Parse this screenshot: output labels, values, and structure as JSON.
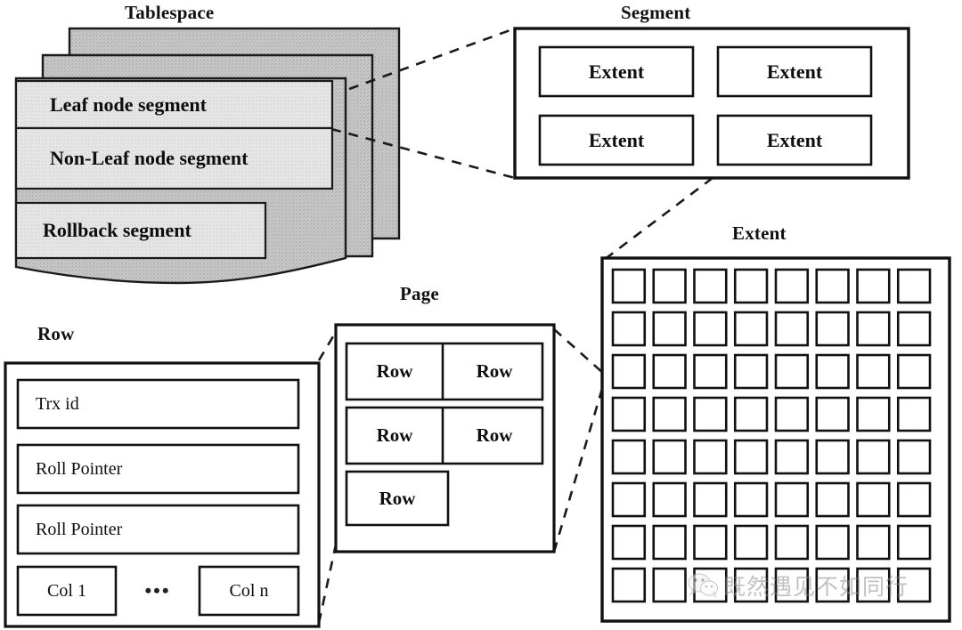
{
  "diagram": {
    "title_labels": {
      "tablespace": "Tablespace",
      "segment": "Segment",
      "extent": "Extent",
      "page": "Page",
      "row": "Row"
    },
    "tablespace": {
      "label": "Tablespace",
      "sheets": 3,
      "segments": [
        "Leaf node segment",
        "Non-Leaf node segment",
        "Rollback segment"
      ],
      "fill_color": "#c9c9c9",
      "segment_fill_color": "#e2e2e2",
      "stroke_color": "#1a1a1a"
    },
    "segment": {
      "label": "Segment",
      "extents": [
        "Extent",
        "Extent",
        "Extent",
        "Extent"
      ],
      "columns": 2,
      "rows": 2,
      "stroke_color": "#111111"
    },
    "extent": {
      "label": "Extent",
      "grid_rows": 8,
      "grid_cols": 8,
      "cell_count": 64,
      "stroke_color": "#111111"
    },
    "page": {
      "label": "Page",
      "rows": [
        [
          "Row",
          "Row"
        ],
        [
          "Row",
          "Row"
        ],
        [
          "Row"
        ]
      ],
      "stroke_color": "#111111"
    },
    "row": {
      "label": "Row",
      "fields": [
        "Trx id",
        "Roll Pointer",
        "Roll Pointer"
      ],
      "columns": {
        "first": "Col 1",
        "ellipsis": "•••",
        "last": "Col n"
      },
      "stroke_color": "#111111"
    },
    "connectors": [
      {
        "from": "tablespace",
        "to": "segment"
      },
      {
        "from": "segment",
        "to": "extent"
      },
      {
        "from": "extent",
        "to": "page"
      },
      {
        "from": "page",
        "to": "row"
      }
    ]
  },
  "watermark": {
    "icon": "wechat-icon",
    "text": "既然遇见不如同行"
  }
}
